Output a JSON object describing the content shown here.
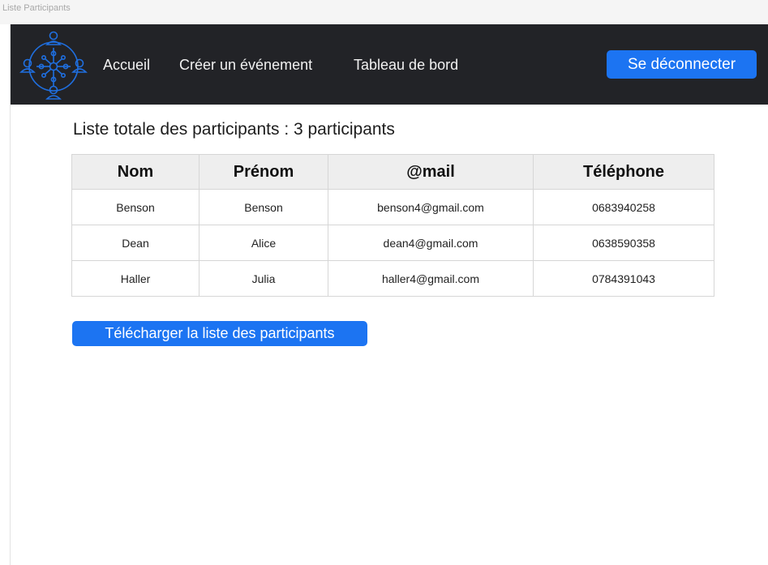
{
  "window": {
    "title": "Liste Participants"
  },
  "navbar": {
    "logo_icon": "network-people-logo-icon",
    "links": [
      {
        "label": "Accueil"
      },
      {
        "label": "Créer un événement"
      },
      {
        "label": "Tableau de bord"
      }
    ],
    "logout_label": "Se déconnecter"
  },
  "main": {
    "title": "Liste totale des participants : 3 participants",
    "table": {
      "headers": [
        "Nom",
        "Prénom",
        "@mail",
        "Téléphone"
      ],
      "rows": [
        [
          "Benson",
          "Benson",
          "benson4@gmail.com",
          "0683940258"
        ],
        [
          "Dean",
          "Alice",
          "dean4@gmail.com",
          "0638590358"
        ],
        [
          "Haller",
          "Julia",
          "haller4@gmail.com",
          "0784391043"
        ]
      ]
    },
    "download_label": "Télécharger la liste des participants"
  },
  "colors": {
    "navbar_bg": "#222327",
    "accent": "#1c74f2",
    "logo": "#1f6fe0"
  }
}
